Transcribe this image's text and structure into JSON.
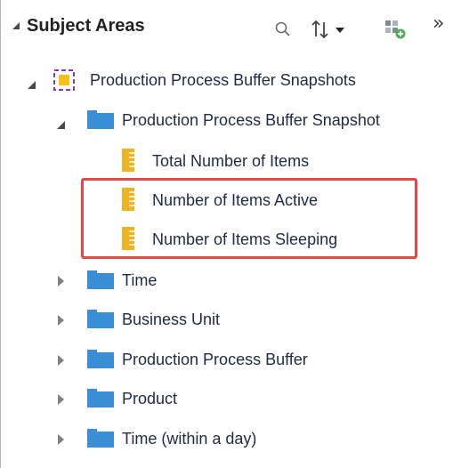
{
  "panel": {
    "title": "Subject Areas",
    "icons": {
      "collapse": "collapse-triangle-icon",
      "search": "search-icon",
      "sort": "sort-icon",
      "add": "add-subject-area-icon",
      "more": "more-chevrons-icon"
    },
    "more_glyph": "»"
  },
  "tree": {
    "root": {
      "label": "Production Process Buffer Snapshots",
      "icon": "subject-area-icon",
      "expanded": true
    },
    "snapshot_folder": {
      "label": "Production Process Buffer Snapshot",
      "icon": "folder-icon",
      "expanded": true,
      "measures": [
        {
          "label": "Total Number of Items",
          "icon": "measure-icon"
        },
        {
          "label": "Number of Items Active",
          "icon": "measure-icon"
        },
        {
          "label": "Number of Items Sleeping",
          "icon": "measure-icon"
        }
      ]
    },
    "folders": [
      {
        "label": "Time",
        "icon": "folder-icon",
        "expanded": false
      },
      {
        "label": "Business Unit",
        "icon": "folder-icon",
        "expanded": false
      },
      {
        "label": "Production Process Buffer",
        "icon": "folder-icon",
        "expanded": false
      },
      {
        "label": "Product",
        "icon": "folder-icon",
        "expanded": false
      },
      {
        "label": "Time (within a day)",
        "icon": "folder-icon",
        "expanded": false
      }
    ]
  },
  "colors": {
    "highlight": "#e34b4b",
    "folder": "#3a8ed6",
    "measure": "#f0b323",
    "subject_area_frame": "#7a3fa0",
    "subject_area_fill": "#f2c21b"
  }
}
